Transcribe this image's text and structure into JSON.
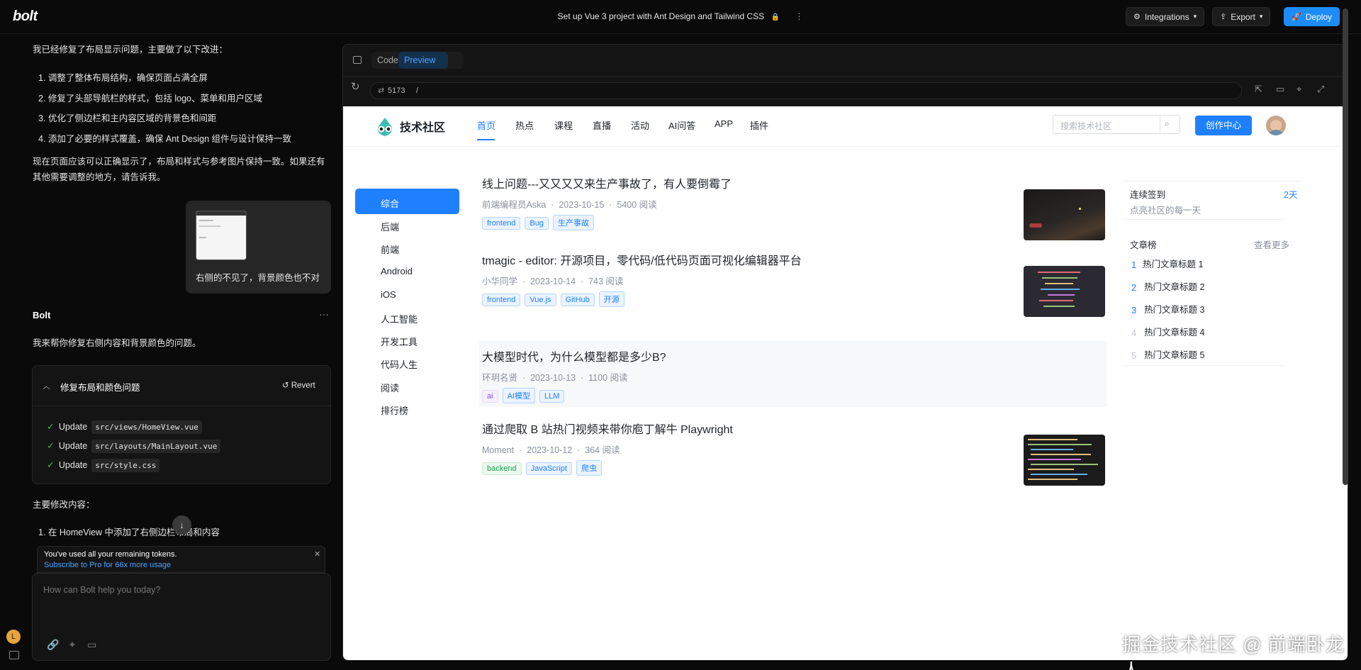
{
  "topbar": {
    "logo": "bolt",
    "project_title": "Set up Vue 3 project with Ant Design and Tailwind CSS",
    "integrations": "Integrations",
    "export": "Export",
    "deploy": "Deploy"
  },
  "chat": {
    "intro": "我已经修复了布局显示问题，主要做了以下改进：",
    "fixes": [
      "1. 调整了整体布局结构，确保页面占满全屏",
      "2. 修复了头部导航栏的样式，包括 logo、菜单和用户区域",
      "3. 优化了侧边栏和主内容区域的背景色和间距",
      "4. 添加了必要的样式覆盖，确保 Ant Design 组件与设计保持一致"
    ],
    "summary_line1": "现在页面应该可以正确显示了，布局和样式与参考图片保持一致。如果还有",
    "summary_line2": "其他需要调整的地方，请告诉我。",
    "user_message": "右侧的不见了，背景颜色也不对",
    "bot_name": "Bolt",
    "bot_reply": "我来帮你修复右侧内容和背景颜色的问题。",
    "card": {
      "title": "修复布局和颜色问题",
      "revert": "Revert",
      "updates": [
        {
          "verb": "Update",
          "file": "src/views/HomeView.vue"
        },
        {
          "verb": "Update",
          "file": "src/layouts/MainLayout.vue"
        },
        {
          "verb": "Update",
          "file": "src/style.css"
        }
      ]
    },
    "changes_heading": "主要修改内容：",
    "change_1": "1. 在 HomeView 中添加了右侧边栏布局和内容",
    "token_notice": "You've used all your remaining tokens.",
    "token_link": "Subscribe to Pro for 66x more usage",
    "input_placeholder": "How can Bolt help you today?",
    "avatar_letter": "L"
  },
  "preview": {
    "tab_code": "Code",
    "tab_preview": "Preview",
    "port": "5173",
    "path": "/"
  },
  "site": {
    "brand": "技术社区",
    "nav": [
      "首页",
      "热点",
      "课程",
      "直播",
      "活动",
      "AI问答",
      "APP",
      "插件"
    ],
    "search_placeholder": "搜索技术社区",
    "create_button": "创作中心",
    "categories": [
      "综合",
      "后端",
      "前端",
      "Android",
      "iOS",
      "人工智能",
      "开发工具",
      "代码人生",
      "阅读",
      "排行榜"
    ],
    "articles": [
      {
        "title": "线上问题---又又又又来生产事故了，有人要倒霉了",
        "author": "前端编程员Aska",
        "date": "2023-10-15",
        "reads": "5400 阅读",
        "tags": [
          "frontend",
          "Bug",
          "生产事故"
        ]
      },
      {
        "title": "tmagic - editor: 开源项目，零代码/低代码页面可视化编辑器平台",
        "author": "小华同学",
        "date": "2023-10-14",
        "reads": "743 阅读",
        "tags": [
          "frontend",
          "Vue.js",
          "GitHub",
          "开源"
        ]
      },
      {
        "title": "大模型时代，为什么模型都是多少B?",
        "author": "环玥名贤",
        "date": "2023-10-13",
        "reads": "1100 阅读",
        "tags": [
          "ai",
          "AI模型",
          "LLM"
        ]
      },
      {
        "title": "通过爬取 B 站热门视频来带你庖丁解牛 Playwright",
        "author": "Moment",
        "date": "2023-10-12",
        "reads": "364 阅读",
        "tags": [
          "backend",
          "JavaScript",
          "爬虫"
        ]
      }
    ],
    "checkin_label": "连续签到",
    "checkin_days": "2天",
    "checkin_sub": "点亮社区的每一天",
    "ranking_title": "文章榜",
    "ranking_more": "查看更多",
    "ranking": [
      {
        "num": "1",
        "title": "热门文章标题 1"
      },
      {
        "num": "2",
        "title": "热门文章标题 2"
      },
      {
        "num": "3",
        "title": "热门文章标题 3"
      },
      {
        "num": "4",
        "title": "热门文章标题 4"
      },
      {
        "num": "5",
        "title": "热门文章标题 5"
      }
    ]
  },
  "watermark": "掘金技术社区 @ 前端卧龙人",
  "colors": {
    "accent": "#1e80ff",
    "bolt_blue": "#1d8cf8",
    "dark_bg": "#0a0a0a"
  }
}
